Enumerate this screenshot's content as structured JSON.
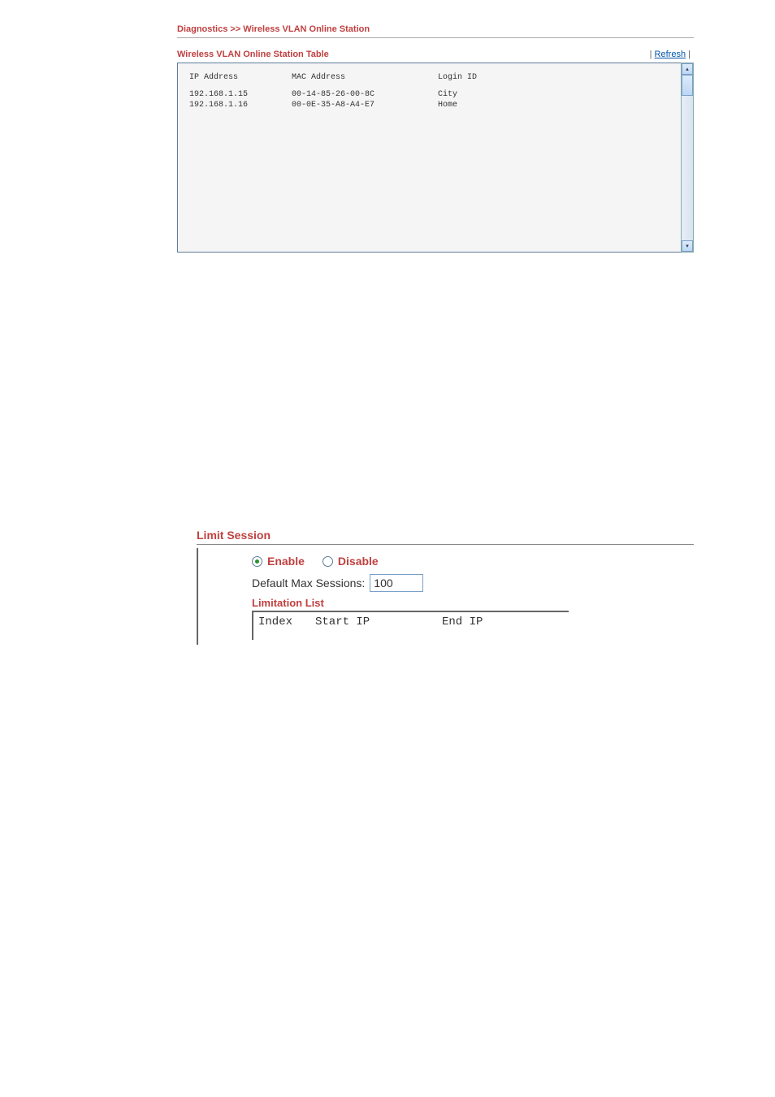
{
  "section1": {
    "breadcrumb": "Diagnostics >> Wireless VLAN Online Station",
    "table_title": "Wireless VLAN Online Station Table",
    "refresh_label": "Refresh",
    "columns": {
      "ip": "IP Address",
      "mac": "MAC Address",
      "login": "Login ID"
    },
    "rows": [
      {
        "ip": "192.168.1.15",
        "mac": "00-14-85-26-00-8C",
        "login": "City"
      },
      {
        "ip": "192.168.1.16",
        "mac": "00-0E-35-A8-A4-E7",
        "login": "Home"
      }
    ]
  },
  "section2": {
    "title": "Limit Session",
    "enable_label": "Enable",
    "disable_label": "Disable",
    "selected": "enable",
    "sessions_label": "Default Max Sessions:",
    "sessions_value": "100",
    "sub_title": "Limitation List",
    "columns": {
      "index": "Index",
      "start_ip": "Start IP",
      "end_ip": "End IP"
    }
  }
}
